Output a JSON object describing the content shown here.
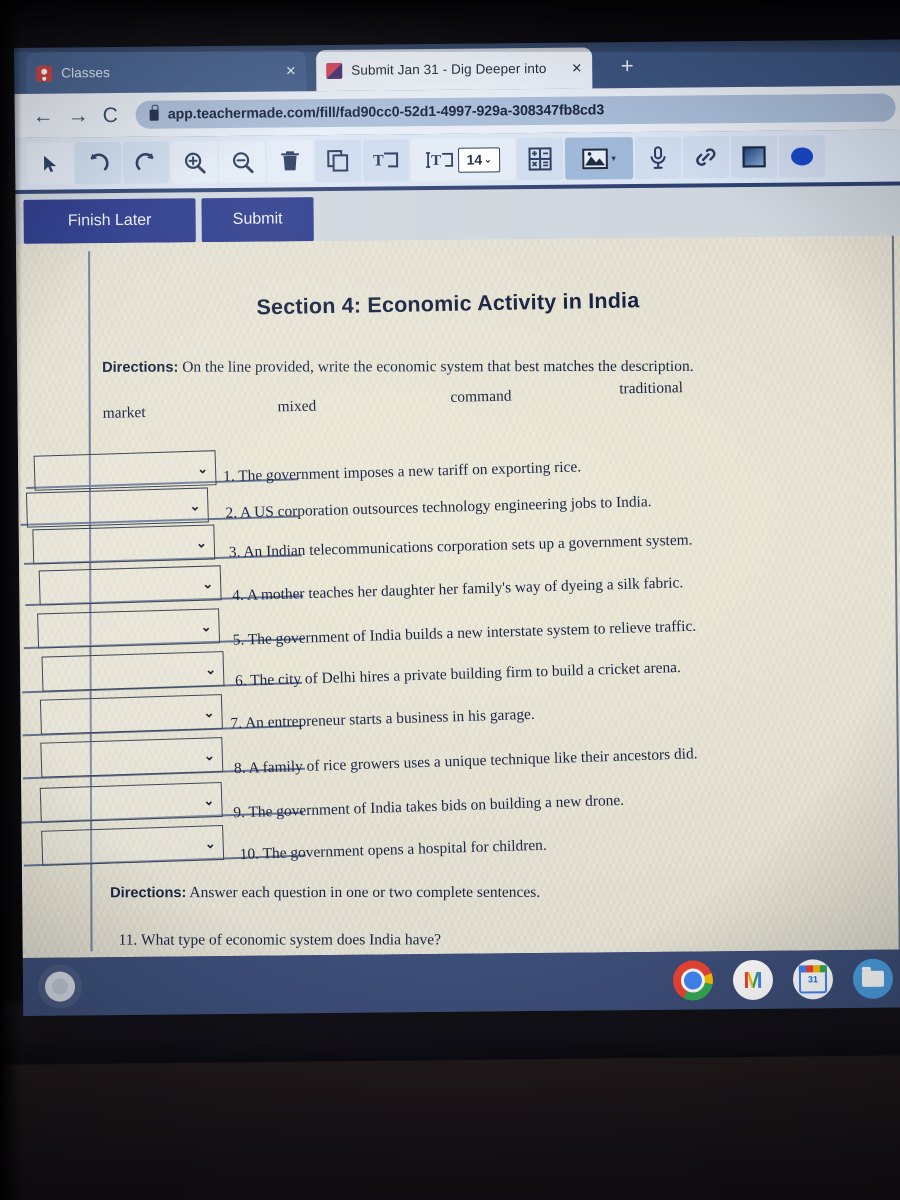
{
  "browser": {
    "tabs": [
      {
        "title": "Classes",
        "favicon": "classroom-icon",
        "active": false,
        "close_label": "✕"
      },
      {
        "title": "Submit Jan 31 - Dig Deeper into",
        "favicon": "teachermade-icon",
        "active": true,
        "close_label": "✕"
      }
    ],
    "new_tab_label": "+",
    "nav": {
      "back": "←",
      "forward": "→",
      "reload": "C"
    },
    "url": "app.teachermade.com/fill/fad90cc0-52d1-4997-929a-308347fb8cd3",
    "secure_icon": "lock-icon"
  },
  "editor_toolbar": {
    "tools": [
      {
        "name": "cursor-tool",
        "icon": "cursor-icon",
        "state": "pale"
      },
      {
        "name": "undo-tool",
        "icon": "undo-icon",
        "state": "normal"
      },
      {
        "name": "redo-tool",
        "icon": "redo-icon",
        "state": "normal"
      },
      {
        "name": "zoom-in-tool",
        "icon": "zoom-in-icon",
        "state": "normal"
      },
      {
        "name": "zoom-out-tool",
        "icon": "zoom-out-icon",
        "state": "normal"
      },
      {
        "name": "delete-tool",
        "icon": "trash-icon",
        "state": "pale"
      },
      {
        "name": "duplicate-tool",
        "icon": "copy-icon",
        "state": "normal"
      },
      {
        "name": "text-box-tool",
        "icon": "text-box-icon",
        "state": "normal"
      },
      {
        "name": "font-size-tool",
        "icon": "text-height-icon",
        "state": "pale"
      },
      {
        "name": "equation-tool",
        "icon": "math-grid-icon",
        "state": "normal"
      },
      {
        "name": "image-tool",
        "icon": "image-icon",
        "state": "selected"
      },
      {
        "name": "audio-tool",
        "icon": "microphone-icon",
        "state": "normal"
      },
      {
        "name": "link-tool",
        "icon": "link-icon",
        "state": "normal"
      },
      {
        "name": "rectangle-tool",
        "icon": "square-icon",
        "state": "normal"
      },
      {
        "name": "ellipse-tool",
        "icon": "circle-icon",
        "state": "normal"
      }
    ],
    "font_size_value": "14",
    "font_size_caret": "⌄",
    "image_caret": "▾"
  },
  "actions": {
    "finish_later_label": "Finish Later",
    "submit_label": "Submit"
  },
  "worksheet": {
    "title": "Section 4: Economic Activity in India",
    "directions_1_label": "Directions:",
    "directions_1_text": "On the line provided, write the economic system that best matches the description.",
    "word_bank": [
      "market",
      "mixed",
      "command",
      "traditional"
    ],
    "questions": [
      {
        "number": "1.",
        "text": "The government imposes a new tariff on exporting rice.",
        "answer": "",
        "chevron": "⌄"
      },
      {
        "number": "2.",
        "text": "A US corporation outsources technology engineering jobs to India.",
        "answer": "",
        "chevron": "⌄"
      },
      {
        "number": "3.",
        "text": "An Indian telecommunications corporation sets up a government system.",
        "answer": "",
        "chevron": "⌄"
      },
      {
        "number": "4.",
        "text": "A mother teaches her daughter her family's way of dyeing a silk fabric.",
        "answer": "",
        "chevron": "⌄"
      },
      {
        "number": "5.",
        "text": "The government of India builds a new interstate system to relieve traffic.",
        "answer": "",
        "chevron": "⌄"
      },
      {
        "number": "6.",
        "text": "The city of Delhi hires a private building firm to build a cricket arena.",
        "answer": "",
        "chevron": "⌄"
      },
      {
        "number": "7.",
        "text": "An entrepreneur starts a business in his garage.",
        "answer": "",
        "chevron": "⌄"
      },
      {
        "number": "8.",
        "text": "A family of rice growers uses a unique technique like their ancestors did.",
        "answer": "",
        "chevron": "⌄"
      },
      {
        "number": "9.",
        "text": "The government of India takes bids on building a new drone.",
        "answer": "",
        "chevron": "⌄"
      },
      {
        "number": "10.",
        "text": "The government opens a hospital for children.",
        "answer": "",
        "chevron": "⌄"
      }
    ],
    "directions_2_label": "Directions:",
    "directions_2_text": "Answer each question in one or two complete sentences.",
    "question_11": "11. What type of economic system does India have?",
    "question_11_answer": ""
  },
  "shelf": {
    "launcher_name": "launcher-button",
    "icons": [
      {
        "name": "chrome-icon",
        "label": "Chrome",
        "active": true
      },
      {
        "name": "gmail-icon",
        "label": "M",
        "active": false
      },
      {
        "name": "calendar-icon",
        "label": "31",
        "active": false
      },
      {
        "name": "files-icon",
        "label": "Files",
        "active": false
      }
    ]
  },
  "colors": {
    "chrome_tabstrip": "#3c547f",
    "button_navy": "#2b3a8c",
    "paper": "#e6e2d6",
    "shelf": "#3c4d77",
    "toolbar": "#dbe5f2"
  }
}
